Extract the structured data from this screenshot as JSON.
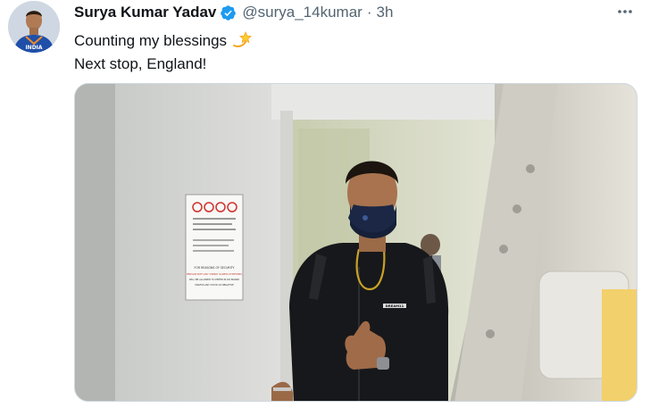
{
  "tweet": {
    "author": {
      "display_name": "Surya Kumar Yadav",
      "handle": "@surya_14kumar",
      "verified": true,
      "avatar_icon": "profile-photo",
      "avatar_jersey_text": "INDIA"
    },
    "separator": "·",
    "timestamp": "3h",
    "text_lines": [
      "Counting my blessings",
      "Next stop, England!"
    ],
    "emoji_icon": "dizzy-star-emoji",
    "more_icon": "more-dots-icon",
    "media": {
      "icon": "photo-man-boarding-aircraft",
      "sign_heading": "FOR REASONS OF SECURITY",
      "sign_lines": [
        "PERSON WITH ANY VISIBLE ILLNESS SYMPTOMS",
        "WILL BE ALLOWED TO ENTER IN OR BOARD",
        "UNLESS ANY COVID-19 NEGATIVE"
      ],
      "jacket_brand": "DREAM11"
    }
  },
  "colors": {
    "text_primary": "#0f1419",
    "text_secondary": "#536471",
    "verified_blue": "#1d9bf0",
    "border": "#cfd9de"
  }
}
